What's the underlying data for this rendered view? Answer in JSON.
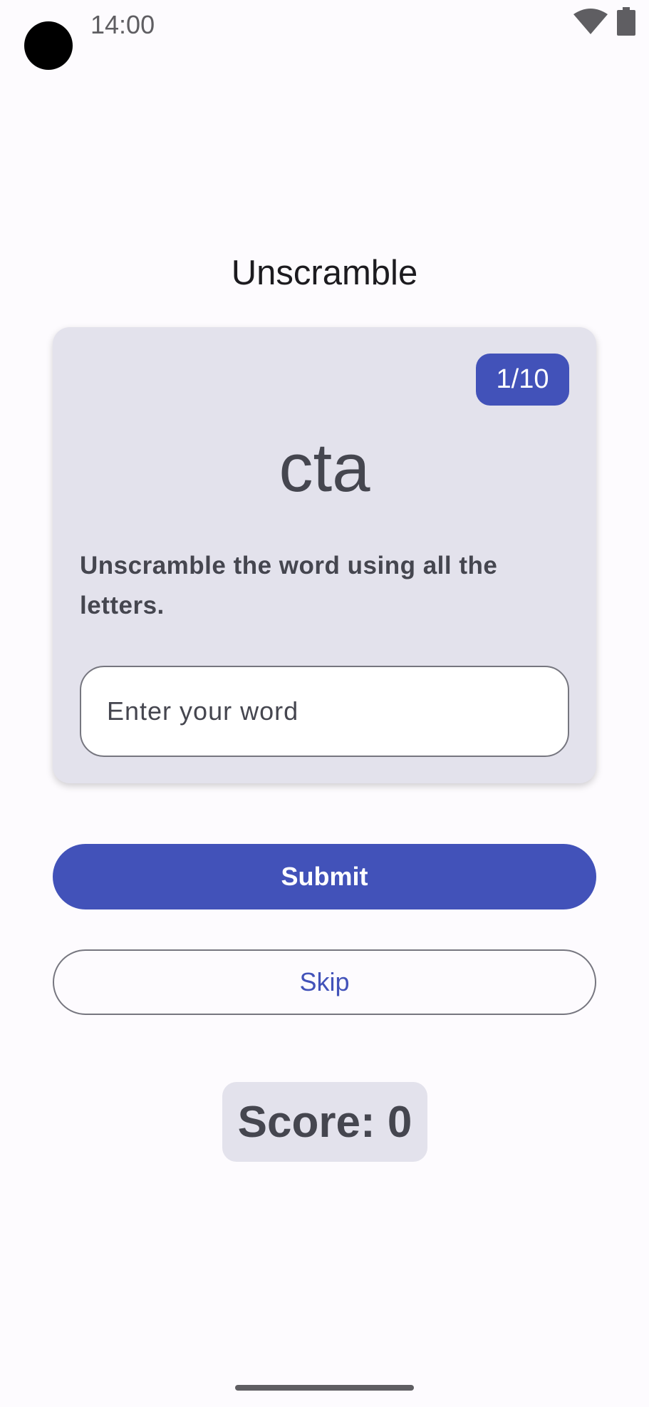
{
  "status_bar": {
    "time": "14:00",
    "icons": [
      "wifi-icon",
      "battery-icon"
    ]
  },
  "title": "Unscramble",
  "card": {
    "word_count": "1/10",
    "scrambled_word": "cta",
    "instructions": "Unscramble the word using all the letters.",
    "input": {
      "value": "",
      "placeholder": "Enter your word"
    }
  },
  "buttons": {
    "submit_label": "Submit",
    "skip_label": "Skip"
  },
  "score": {
    "text": "Score: 0"
  },
  "colors": {
    "primary": "#4252b9",
    "card_background": "#e3e2ec",
    "background": "#fdfbfe",
    "on_surface_variant": "#45464f"
  }
}
